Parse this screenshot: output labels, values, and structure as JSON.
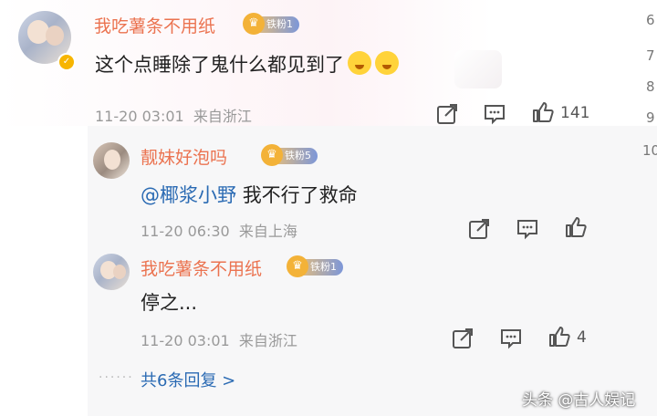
{
  "comment": {
    "username": "我吃薯条不用纸",
    "fan_badge": "铁粉1",
    "text": "这个点睡除了鬼什么都见到了",
    "time": "11-20 03:01",
    "location": "来自浙江",
    "likes": "141"
  },
  "replies": [
    {
      "username": "靓妹好泡吗",
      "fan_badge": "铁粉5",
      "mention": "@椰浆小野",
      "text": "我不行了救命",
      "time": "11-20 06:30",
      "location": "来自上海",
      "likes": ""
    },
    {
      "username": "我吃薯条不用纸",
      "fan_badge": "铁粉1",
      "text": "停之...",
      "time": "11-20 03:01",
      "location": "来自浙江",
      "likes": "4"
    }
  ],
  "more_replies": "共6条回复 >",
  "right_edge_numbers": [
    "6",
    "7",
    "8",
    "9",
    "10"
  ],
  "watermark": "头条 @古人娱记",
  "icons": {
    "share": "share-icon",
    "comment": "comment-icon",
    "like": "thumbs-up-icon",
    "verified": "verified-badge-icon",
    "crown": "fan-crown-icon"
  },
  "colors": {
    "username": "#eb7350",
    "link": "#2a6ab3",
    "meta": "#999999",
    "reply_bg": "#f7f7f8"
  }
}
